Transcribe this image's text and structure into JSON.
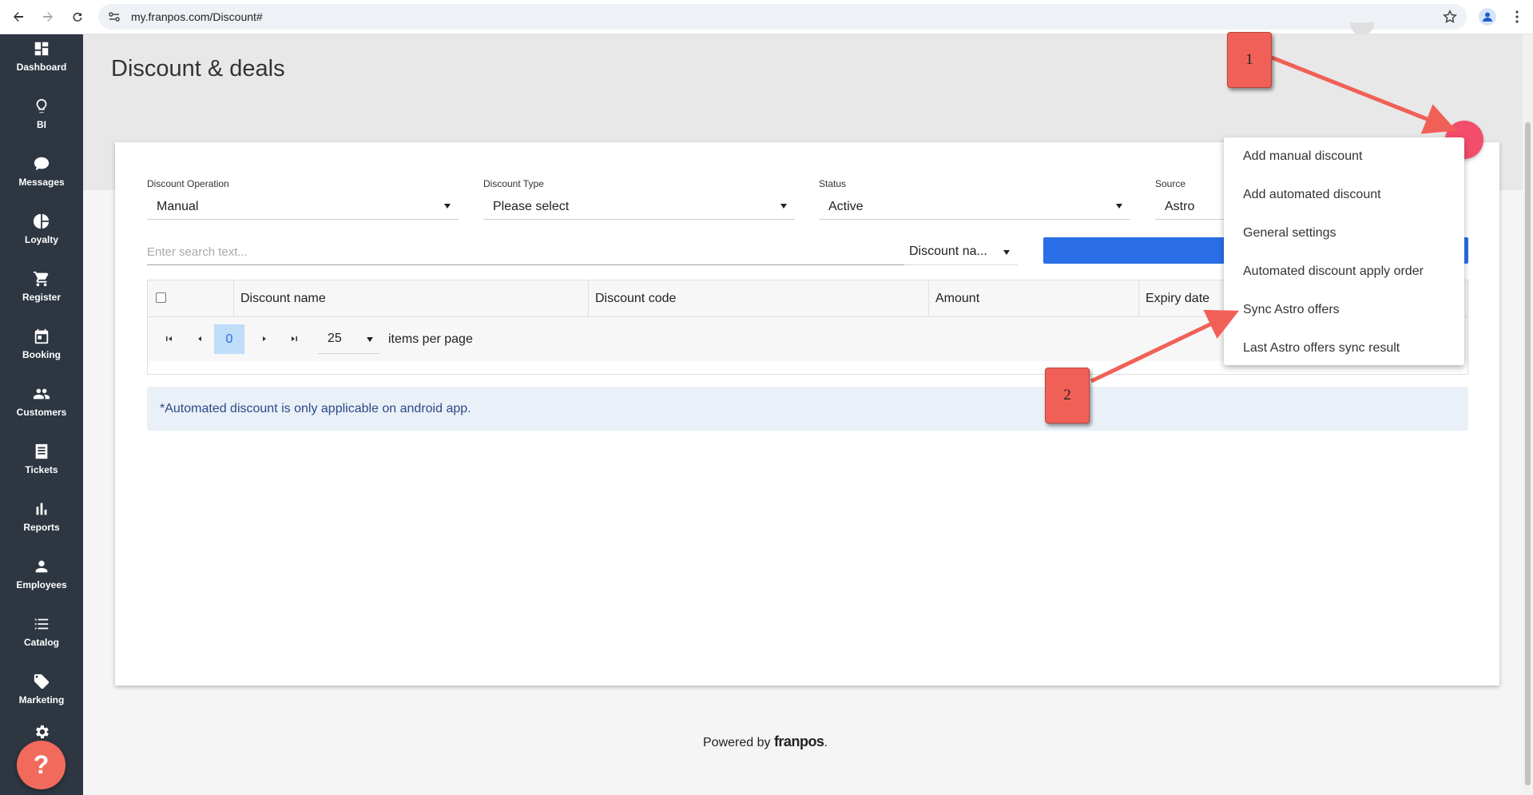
{
  "browser": {
    "url": "my.franpos.com/Discount#"
  },
  "sidebar": {
    "items": [
      {
        "label": "Dashboard",
        "icon": "dashboard-icon"
      },
      {
        "label": "BI",
        "icon": "lightbulb-icon"
      },
      {
        "label": "Messages",
        "icon": "chat-bubble-icon"
      },
      {
        "label": "Loyalty",
        "icon": "pie-chart-icon"
      },
      {
        "label": "Register",
        "icon": "shopping-cart-icon"
      },
      {
        "label": "Booking",
        "icon": "calendar-icon"
      },
      {
        "label": "Customers",
        "icon": "people-icon"
      },
      {
        "label": "Tickets",
        "icon": "receipt-icon"
      },
      {
        "label": "Reports",
        "icon": "bar-chart-icon"
      },
      {
        "label": "Employees",
        "icon": "person-icon"
      },
      {
        "label": "Catalog",
        "icon": "list-icon"
      },
      {
        "label": "Marketing",
        "icon": "tag-icon"
      }
    ],
    "help_label": "?"
  },
  "page": {
    "title": "Discount & deals"
  },
  "filters": {
    "operation": {
      "label": "Discount Operation",
      "value": "Manual"
    },
    "type": {
      "label": "Discount Type",
      "value": "Please select"
    },
    "status": {
      "label": "Status",
      "value": "Active"
    },
    "source": {
      "label": "Source",
      "value": "Astro"
    }
  },
  "search": {
    "placeholder": "Enter search text...",
    "field_value": "Discount na..."
  },
  "table": {
    "columns": [
      "Discount name",
      "Discount code",
      "Amount",
      "Expiry date"
    ]
  },
  "pager": {
    "current_page": "0",
    "page_size": "25",
    "label": "items per page"
  },
  "info": {
    "text": "*Automated discount is only applicable on android app."
  },
  "footer": {
    "prefix": "Powered by ",
    "brand": "franpos",
    "suffix": "."
  },
  "menu": {
    "items": [
      "Add manual discount",
      "Add automated discount",
      "General settings",
      "Automated discount apply order",
      "Sync Astro offers",
      "Last Astro offers sync result"
    ]
  },
  "annotations": {
    "callout_1": "1",
    "callout_2": "2",
    "color": "#f16057"
  },
  "colors": {
    "sidebar": "#2d3641",
    "primary": "#2a6ee8",
    "fab": "#f24d6b",
    "help": "#f26a5c"
  }
}
